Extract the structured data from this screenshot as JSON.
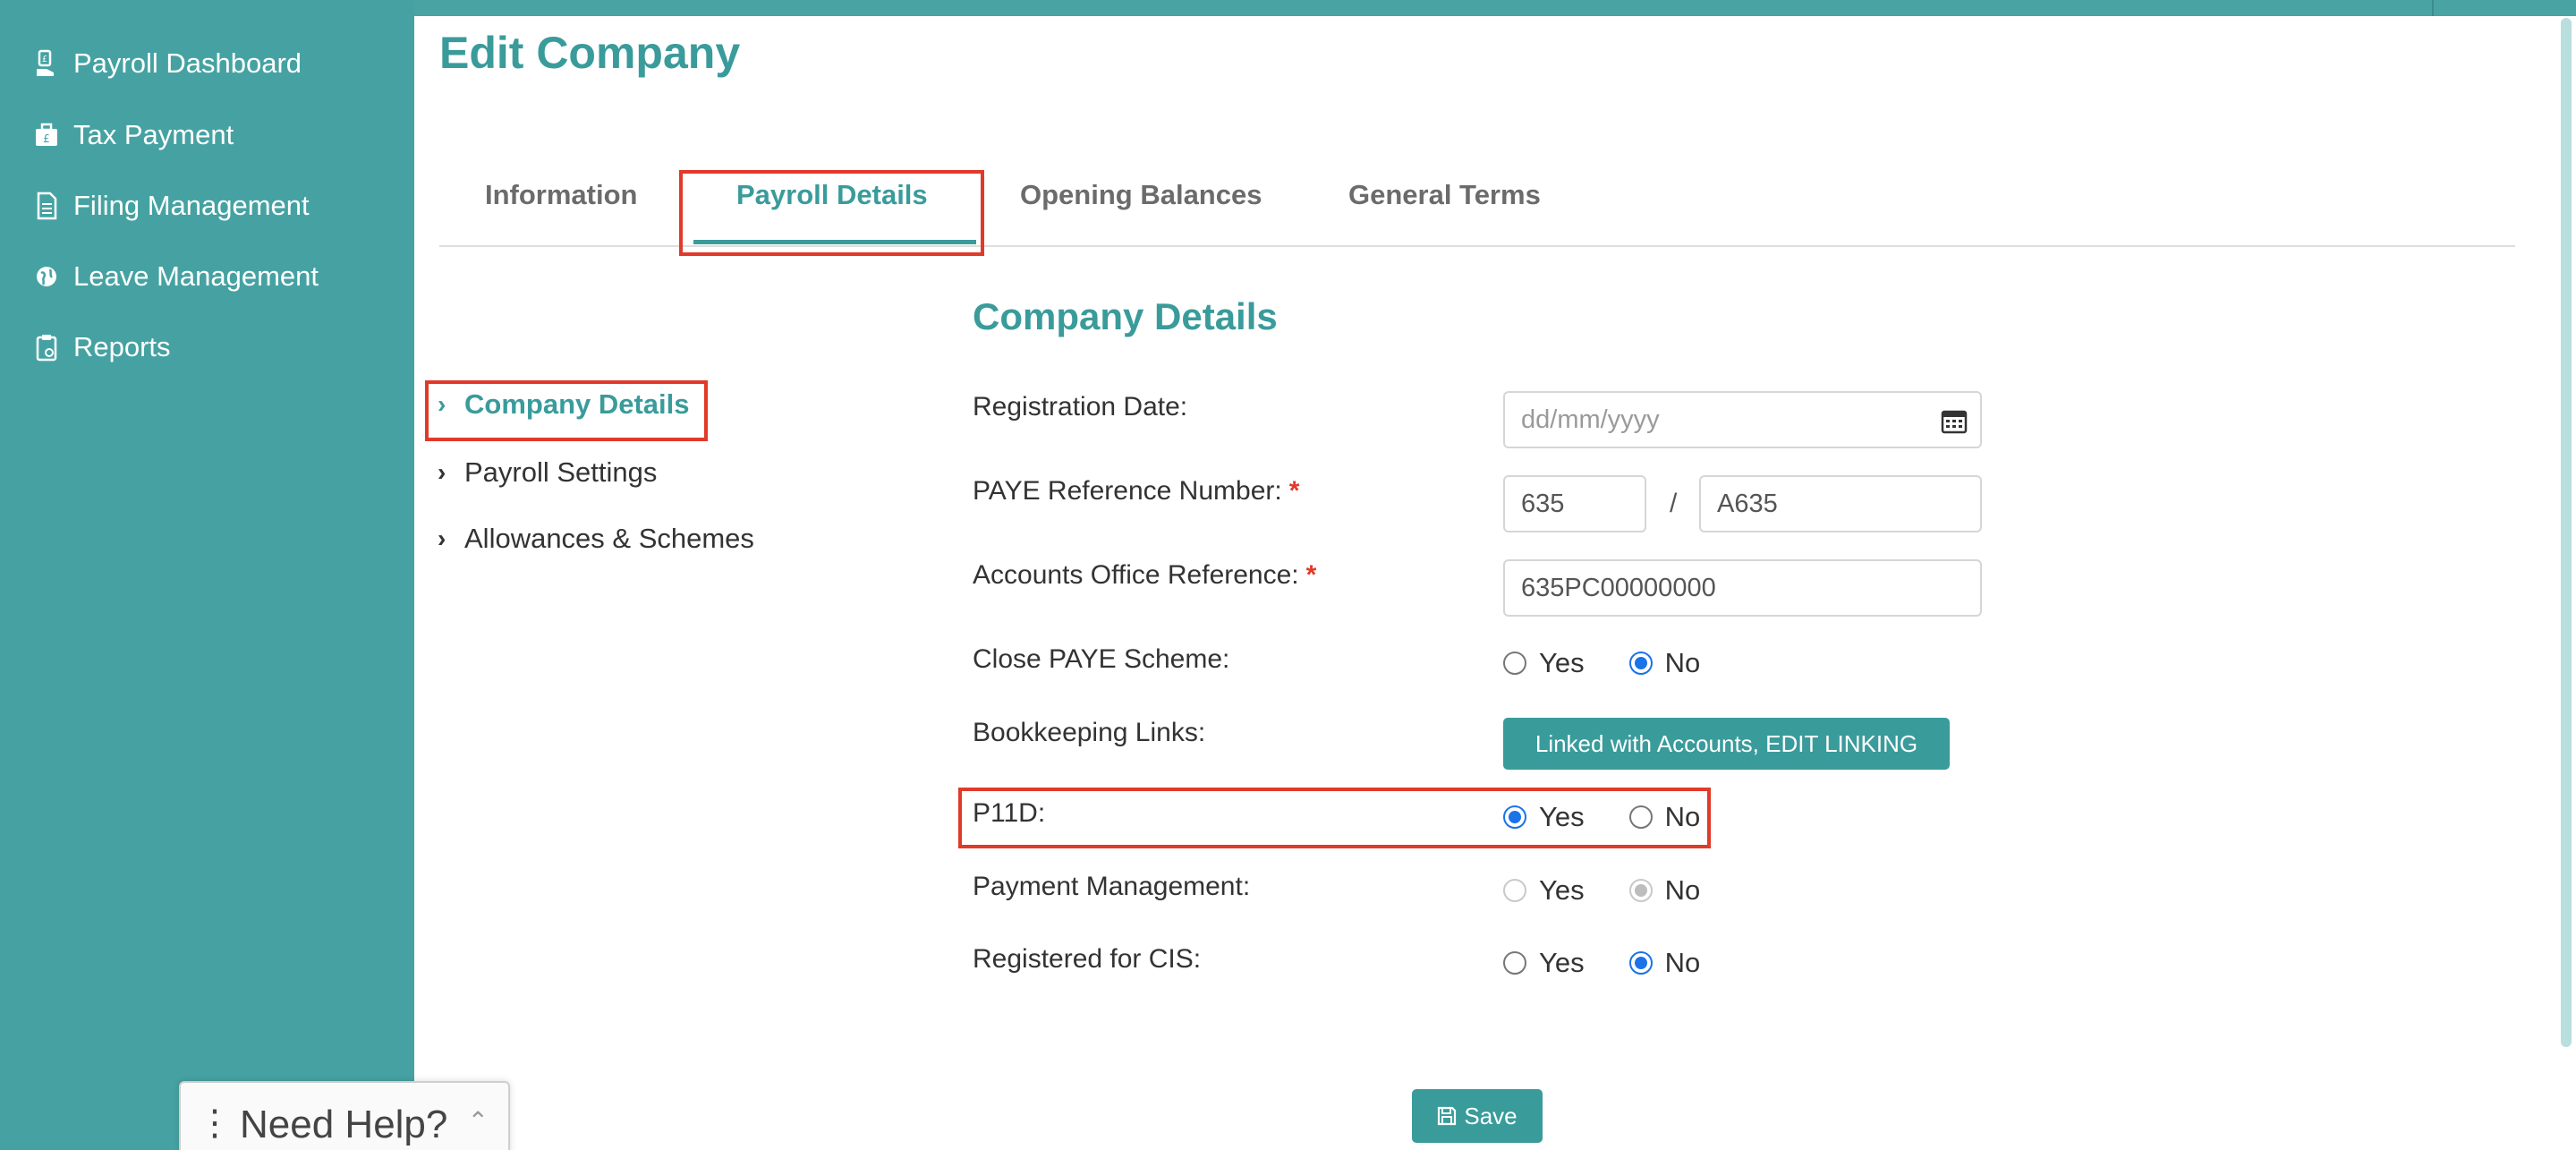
{
  "sidebar": {
    "items": [
      {
        "label": "Payroll Dashboard",
        "icon": "hand-money-icon"
      },
      {
        "label": "Tax Payment",
        "icon": "briefcase-pound-icon"
      },
      {
        "label": "Filing Management",
        "icon": "document-icon"
      },
      {
        "label": "Leave Management",
        "icon": "globe-icon"
      },
      {
        "label": "Reports",
        "icon": "clipboard-icon"
      }
    ]
  },
  "page": {
    "title": "Edit Company"
  },
  "tabs": [
    {
      "label": "Information"
    },
    {
      "label": "Payroll Details"
    },
    {
      "label": "Opening Balances"
    },
    {
      "label": "General Terms"
    }
  ],
  "subnav": [
    {
      "label": "Company Details"
    },
    {
      "label": "Payroll Settings"
    },
    {
      "label": "Allowances & Schemes"
    }
  ],
  "section": {
    "title": "Company Details"
  },
  "form": {
    "registration_date": {
      "label": "Registration Date:",
      "placeholder": "dd/mm/yyyy"
    },
    "paye_ref": {
      "label": "PAYE Reference Number:",
      "required": "*",
      "part1": "635",
      "separator": "/",
      "part2": "A635"
    },
    "accounts_office": {
      "label": "Accounts Office Reference:",
      "required": "*",
      "value": "635PC00000000"
    },
    "close_paye": {
      "label": "Close PAYE Scheme:",
      "yes": "Yes",
      "no": "No",
      "selected": "No"
    },
    "bookkeeping": {
      "label": "Bookkeeping Links:",
      "button": "Linked with Accounts, EDIT LINKING"
    },
    "p11d": {
      "label": "P11D:",
      "yes": "Yes",
      "no": "No",
      "selected": "Yes"
    },
    "payment_mgmt": {
      "label": "Payment Management:",
      "yes": "Yes",
      "no": "No",
      "selected": "No",
      "disabled": true
    },
    "cis": {
      "label": "Registered for CIS:",
      "yes": "Yes",
      "no": "No",
      "selected": "No"
    }
  },
  "actions": {
    "save": "Save"
  },
  "help": {
    "label": "Need Help?",
    "dots": "⋮",
    "caret": "⌃"
  },
  "colors": {
    "accent": "#3a9b9b",
    "sidebar": "#46a2a2",
    "highlight": "#e03a2a",
    "radio": "#1a73e8"
  }
}
